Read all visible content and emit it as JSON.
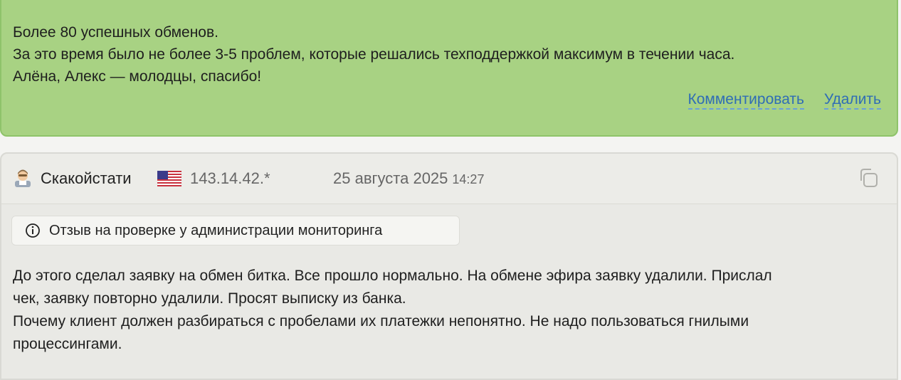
{
  "reviews": [
    {
      "text_lines": [
        "Более 80 успешных обменов.",
        "За это время было не более 3-5 проблем, которые решались техподдержкой максимум в течении часа.",
        "Алёна, Алекс — молодцы, спасибо!"
      ],
      "actions": {
        "comment": "Комментировать",
        "delete": "Удалить"
      },
      "color": "#a8d283"
    },
    {
      "author": "Скакойстати",
      "avatar_icon": "user-avatar-icon",
      "country_flag": "us-flag-icon",
      "ip": "143.14.42.*",
      "date": "25 августа 2025",
      "time": "14:27",
      "copy_icon": "copy-icon",
      "notice": "Отзыв на проверке у администрации мониторинга",
      "notice_icon": "info-icon",
      "text_lines": [
        "До этого сделал заявку на обмен битка. Все прошло нормально. На обмене эфира заявку удалили. Прислал",
        "чек, заявку повторно удалили. Просят выписку из банка.",
        "Почему клиент должен разбираться с пробелами их платежки непонятно. Не надо пользоваться гнилыми",
        "процессингами."
      ],
      "color": "#e9e9e5"
    }
  ],
  "colors": {
    "link": "#2f6db5",
    "green_border": "#8ec36a"
  }
}
